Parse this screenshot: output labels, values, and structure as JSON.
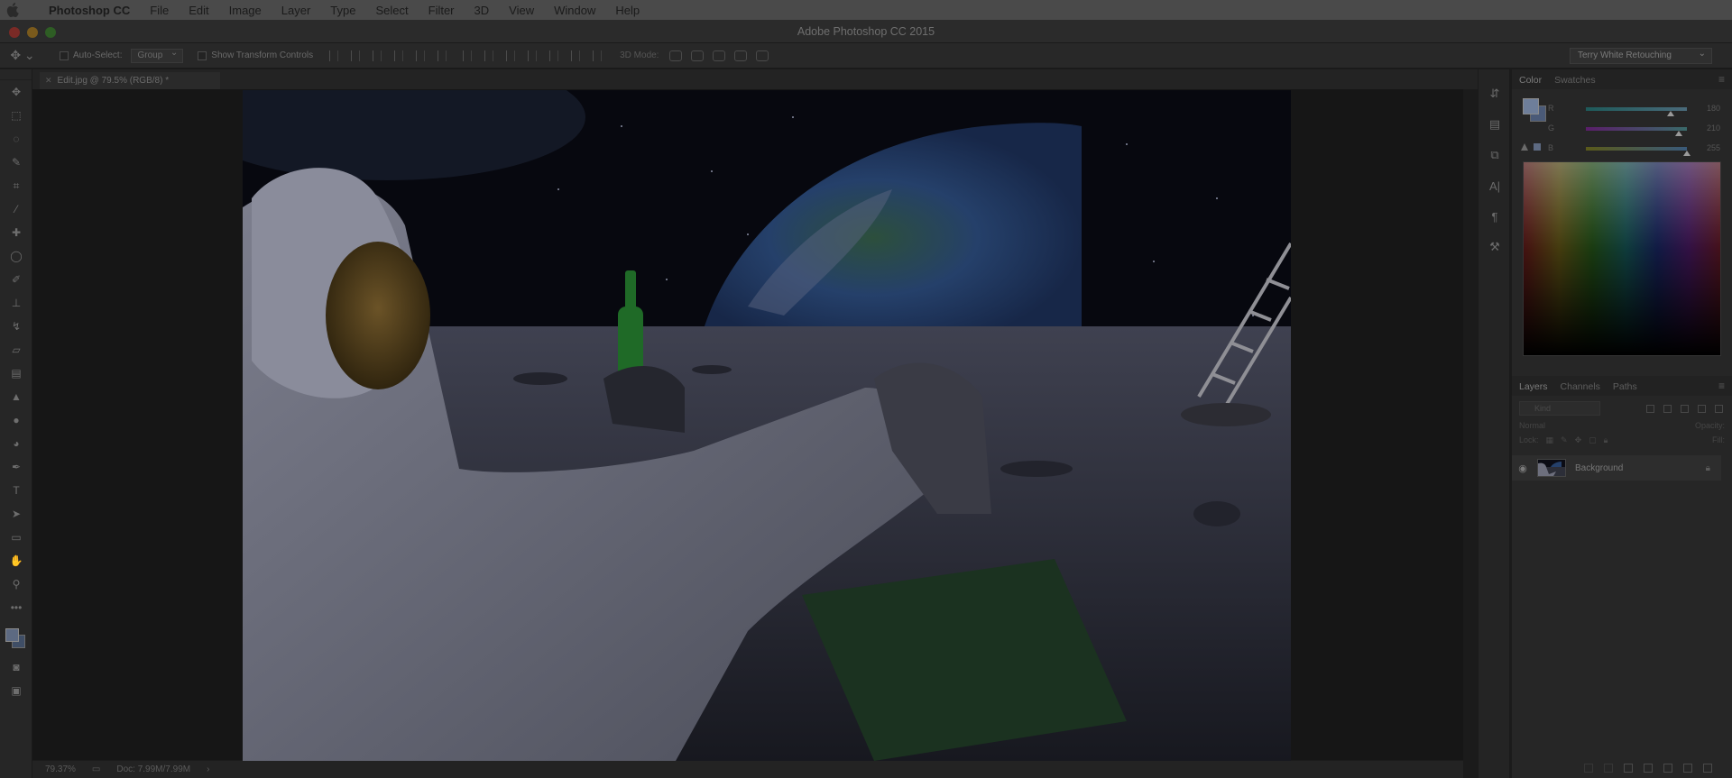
{
  "menubar": {
    "app": "Photoshop CC",
    "items": [
      "File",
      "Edit",
      "Image",
      "Layer",
      "Type",
      "Select",
      "Filter",
      "3D",
      "View",
      "Window",
      "Help"
    ]
  },
  "window": {
    "title": "Adobe Photoshop CC 2015"
  },
  "options": {
    "auto_select": "Auto-Select:",
    "auto_select_mode": "Group",
    "show_transform": "Show Transform Controls",
    "mode_3d": "3D Mode:",
    "workspace": "Terry White Retouching"
  },
  "document": {
    "tab_label": "Edit.jpg @ 79.5% (RGB/8) *",
    "zoom": "79.37%",
    "doc_size": "Doc: 7.99M/7.99M"
  },
  "color_panel": {
    "tabs": [
      "Color",
      "Swatches"
    ],
    "sliders": [
      {
        "label": "R",
        "value": "180",
        "position": 0.84,
        "color_from": "#1e5a5a",
        "color_to": "#4a6a7a"
      },
      {
        "label": "G",
        "value": "210",
        "position": 0.92,
        "color_from": "#5a1e6a",
        "color_to": "#3a6a6a"
      },
      {
        "label": "B",
        "value": "255",
        "position": 1.0,
        "color_from": "#5a5a1a",
        "color_to": "#3a5a7a"
      }
    ],
    "foreground": "#6e7e9a",
    "background": "#4a5a78"
  },
  "layers_panel": {
    "tabs": [
      "Layers",
      "Channels",
      "Paths"
    ],
    "search_placeholder": "Kind",
    "blend_mode": "Normal",
    "opacity_label": "Opacity:",
    "lock_label": "Lock:",
    "fill_label": "Fill:",
    "layers": [
      {
        "name": "Background",
        "visible": true,
        "locked": true
      }
    ]
  },
  "icons": {
    "apple": "apple-icon",
    "move": "move-tool-icon",
    "visibility": "eye-icon",
    "lock": "lock-icon"
  },
  "accent_colors": {
    "traffic_close": "#7a2a26",
    "traffic_min": "#7a5a1c",
    "traffic_max": "#2e5d24"
  }
}
